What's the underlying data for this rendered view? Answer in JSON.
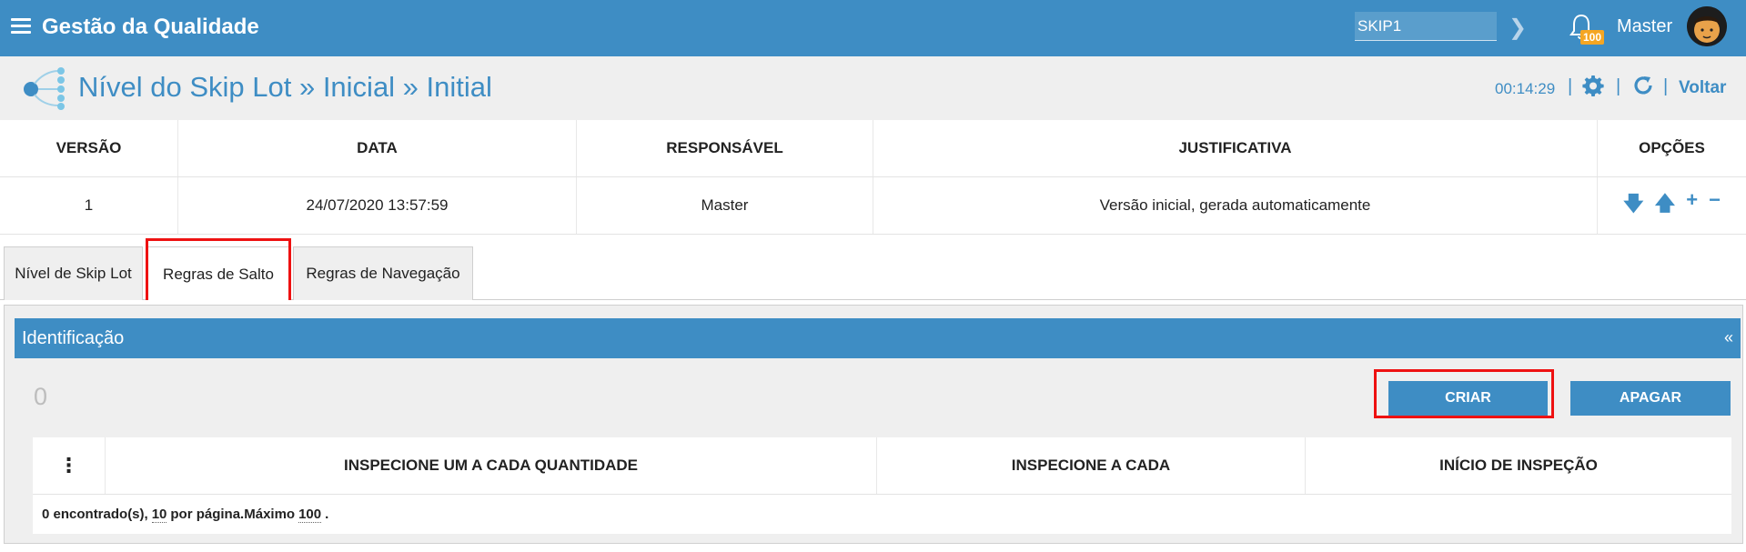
{
  "topbar": {
    "app_title": "Gestão da Qualidade",
    "search_value": "SKIP1",
    "notification_count": "100",
    "user_name": "Master"
  },
  "page_header": {
    "title": "Nível do Skip Lot » Inicial » Initial",
    "timer": "00:14:29",
    "back_label": "Voltar"
  },
  "version_table": {
    "columns": [
      "VERSÃO",
      "DATA",
      "RESPONSÁVEL",
      "JUSTIFICATIVA",
      "OPÇÕES"
    ],
    "rows": [
      {
        "version": "1",
        "date": "24/07/2020 13:57:59",
        "responsible": "Master",
        "justification": "Versão inicial, gerada automaticamente"
      }
    ],
    "options_icons": [
      "arrow-down-icon",
      "arrow-up-icon",
      "plus-icon",
      "minus-icon"
    ]
  },
  "tabs": [
    {
      "label": "Nível de Skip Lot"
    },
    {
      "label": "Regras de Salto"
    },
    {
      "label": "Regras de Navegação"
    }
  ],
  "section": {
    "title": "Identificação",
    "collapse_glyph": "«",
    "count": "0",
    "create_label": "CRIAR",
    "delete_label": "APAGAR"
  },
  "inner_table": {
    "kebab_glyph": "⋮",
    "columns": [
      "INSPECIONE UM A CADA QUANTIDADE",
      "INSPECIONE A CADA",
      "INÍCIO DE INSPEÇÃO"
    ],
    "footer": {
      "found": "0",
      "found_suffix": "encontrado(s),",
      "per_page": "10",
      "per_page_suffix": "por página.Máximo",
      "max": "100",
      "end": "."
    }
  },
  "colors": {
    "primary": "#3e8dc4",
    "header_bg": "#efefef",
    "highlight": "#ee1111",
    "badge": "#f5a623"
  }
}
